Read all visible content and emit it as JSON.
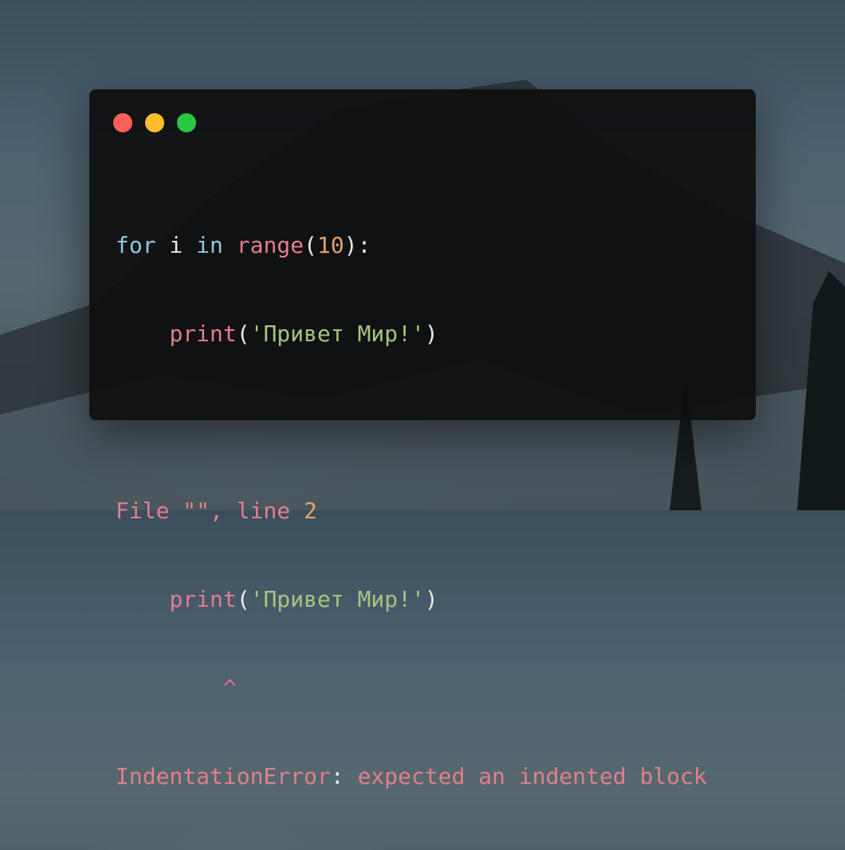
{
  "window": {
    "controls": {
      "close_color": "#fe5f57",
      "minimize_color": "#febc2e",
      "maximize_color": "#28c840"
    }
  },
  "code": {
    "line1": {
      "kw_for": "for",
      "var": " i ",
      "kw_in": "in",
      "space": " ",
      "fn": "range",
      "open": "(",
      "num": "10",
      "close": "):"
    },
    "line2": {
      "indent": "    ",
      "fn": "print",
      "open": "(",
      "str": "'Привет Мир!'",
      "close": ")"
    },
    "line4": {
      "text": "File \"\", line ",
      "num": "2"
    },
    "line5": {
      "indent": "    ",
      "fn": "print",
      "open": "(",
      "str": "'Привет Мир!'",
      "close": ")"
    },
    "line6": {
      "indent": "        ",
      "caret": "^"
    },
    "line7": {
      "error_name": "IndentationError",
      "sep": ": ",
      "message": "expected an indented block"
    }
  },
  "colors": {
    "keyword": "#8ccbe0",
    "function": "#e27e8d",
    "number": "#e0a370",
    "string": "#a6c47e",
    "window_bg": "#0e0e0f"
  }
}
